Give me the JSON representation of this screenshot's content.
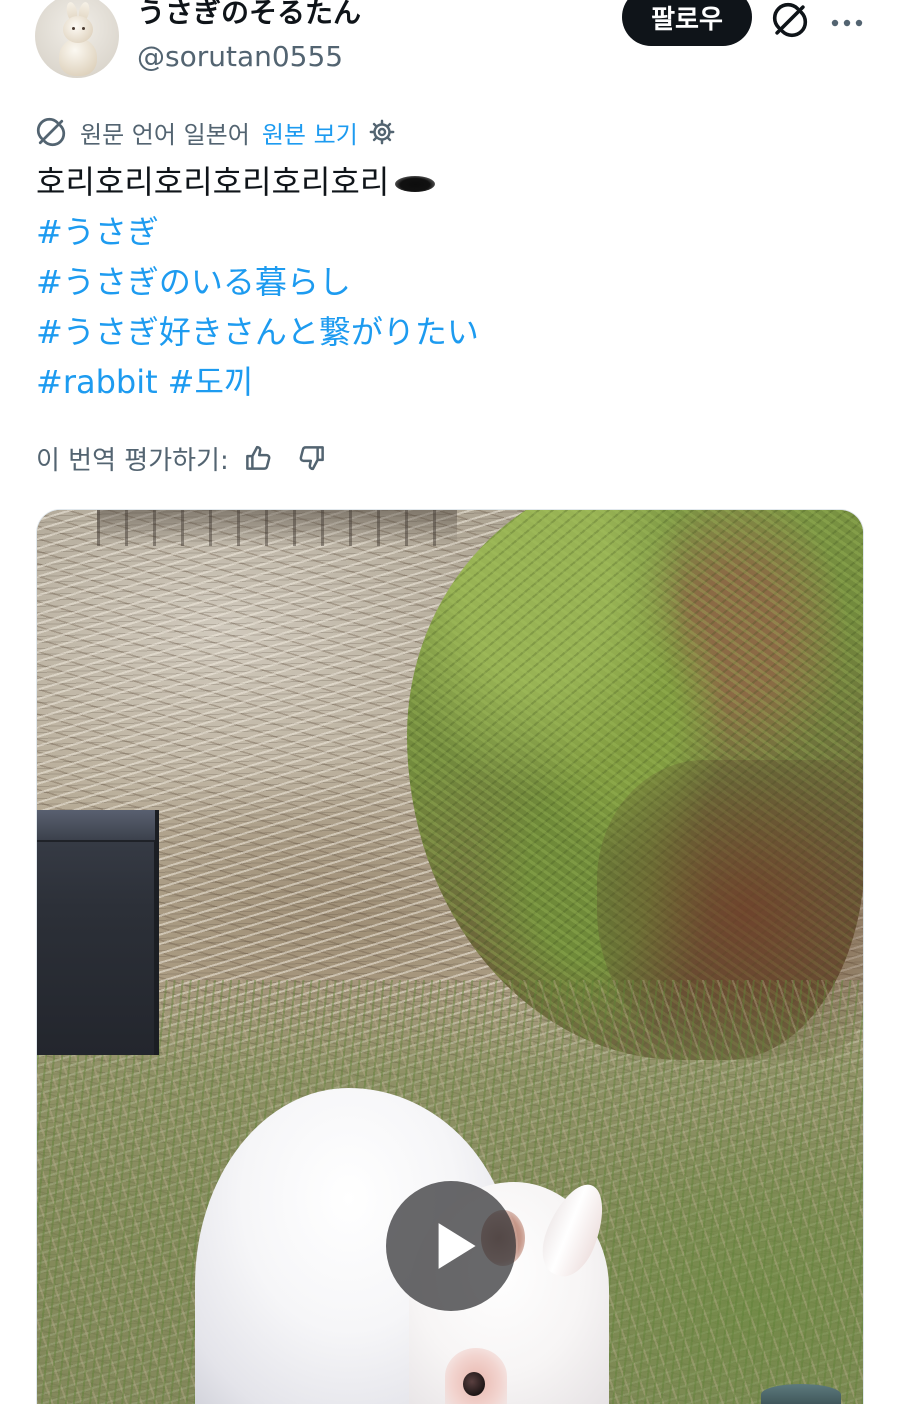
{
  "colors": {
    "text": "#0f1419",
    "secondary": "#536471",
    "accent": "#1d9bf0",
    "follow_button_bg": "#0f1419",
    "background": "#ffffff"
  },
  "author": {
    "display_name": "うさぎのそるたん",
    "handle": "@sorutan0555"
  },
  "header": {
    "follow_label": "팔로우",
    "grok_icon": "grok-icon",
    "more_icon": "more-icon"
  },
  "translation": {
    "icon": "grok-icon",
    "source_note": "원문 언어 일본어",
    "show_original_label": "원본 보기",
    "settings_icon": "gear-icon"
  },
  "post": {
    "text": "호리호리호리호리호리호리",
    "emoji_icon": "hole-emoji-icon",
    "hashtags": [
      "#うさぎ",
      "#うさぎのいる暮らし",
      "#うさぎ好きさんと繋がりたい",
      "#rabbit",
      "#도끼"
    ]
  },
  "rating": {
    "label": "이 번역 평가하기:",
    "like_icon": "thumbs-up-icon",
    "dislike_icon": "thumbs-down-icon"
  },
  "media": {
    "play_icon": "play-icon"
  }
}
